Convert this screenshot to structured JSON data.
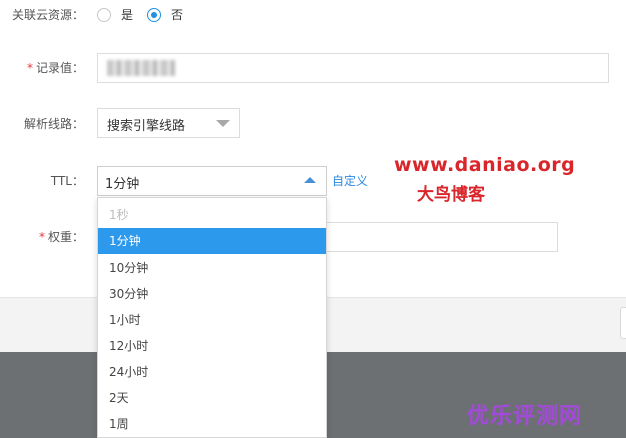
{
  "form": {
    "cloud_resource": {
      "label": "关联云资源：",
      "options": [
        "是",
        "否"
      ],
      "selected": "否"
    },
    "record_value": {
      "required_mark": "*",
      "label": "记录值："
    },
    "line": {
      "label": "解析线路：",
      "value": "搜索引擎线路"
    },
    "ttl": {
      "label": "TTL：",
      "value": "1分钟",
      "custom_link": "自定义"
    },
    "weight": {
      "required_mark": "*",
      "label": "权重："
    }
  },
  "ttl_dropdown": {
    "options": [
      {
        "label": "1秒",
        "state": "disabled"
      },
      {
        "label": "1分钟",
        "state": "selected"
      },
      {
        "label": "10分钟",
        "state": "normal"
      },
      {
        "label": "30分钟",
        "state": "normal"
      },
      {
        "label": "1小时",
        "state": "normal"
      },
      {
        "label": "12小时",
        "state": "normal"
      },
      {
        "label": "24小时",
        "state": "normal"
      },
      {
        "label": "2天",
        "state": "normal"
      },
      {
        "label": "1周",
        "state": "normal"
      }
    ]
  },
  "watermarks": {
    "site": "www.daniao.org",
    "blog": "大鸟博客",
    "corner": "优乐评测网"
  },
  "colors": {
    "accent": "#2d99ec",
    "required": "#e4393c",
    "watermark_red": "#d9262b",
    "watermark_purple": "#a34ad8",
    "footer_dark": "#6c7073"
  }
}
